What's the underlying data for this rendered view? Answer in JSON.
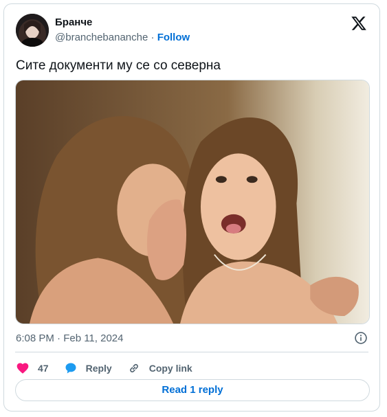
{
  "author": {
    "display_name": "Бранче",
    "handle": "@branchebananche",
    "separator": "·",
    "follow_label": "Follow"
  },
  "tweet": {
    "text": "Сите документи му се со северна",
    "timestamp": "6:08 PM · Feb 11, 2024"
  },
  "actions": {
    "likes_count": "47",
    "reply_label": "Reply",
    "copy_link_label": "Copy link"
  },
  "read_replies_label": "Read 1 reply",
  "colors": {
    "like_heart": "#f91880",
    "reply_bubble": "#1d9bf0",
    "link_blue": "#006fd6",
    "muted_text": "#536471",
    "border": "#cfd9de"
  },
  "icons": {
    "brand": "x-logo-icon",
    "info": "info-icon",
    "like": "heart-icon",
    "reply": "speech-bubble-icon",
    "copy": "link-icon"
  }
}
